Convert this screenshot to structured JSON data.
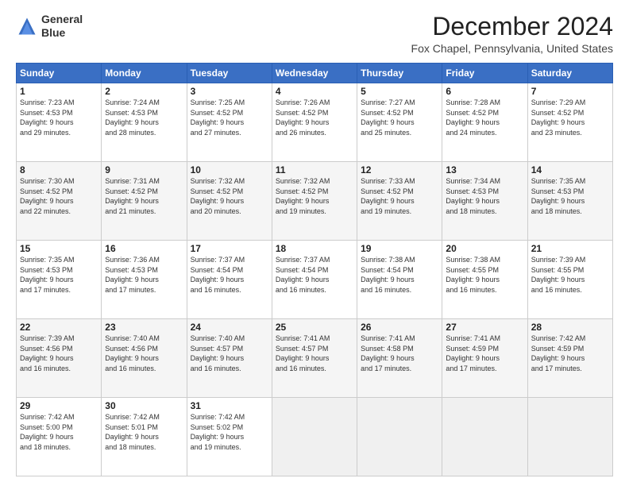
{
  "logo": {
    "line1": "General",
    "line2": "Blue"
  },
  "title": "December 2024",
  "subtitle": "Fox Chapel, Pennsylvania, United States",
  "headers": [
    "Sunday",
    "Monday",
    "Tuesday",
    "Wednesday",
    "Thursday",
    "Friday",
    "Saturday"
  ],
  "weeks": [
    [
      {
        "day": "1",
        "info": "Sunrise: 7:23 AM\nSunset: 4:53 PM\nDaylight: 9 hours\nand 29 minutes."
      },
      {
        "day": "2",
        "info": "Sunrise: 7:24 AM\nSunset: 4:53 PM\nDaylight: 9 hours\nand 28 minutes."
      },
      {
        "day": "3",
        "info": "Sunrise: 7:25 AM\nSunset: 4:52 PM\nDaylight: 9 hours\nand 27 minutes."
      },
      {
        "day": "4",
        "info": "Sunrise: 7:26 AM\nSunset: 4:52 PM\nDaylight: 9 hours\nand 26 minutes."
      },
      {
        "day": "5",
        "info": "Sunrise: 7:27 AM\nSunset: 4:52 PM\nDaylight: 9 hours\nand 25 minutes."
      },
      {
        "day": "6",
        "info": "Sunrise: 7:28 AM\nSunset: 4:52 PM\nDaylight: 9 hours\nand 24 minutes."
      },
      {
        "day": "7",
        "info": "Sunrise: 7:29 AM\nSunset: 4:52 PM\nDaylight: 9 hours\nand 23 minutes."
      }
    ],
    [
      {
        "day": "8",
        "info": "Sunrise: 7:30 AM\nSunset: 4:52 PM\nDaylight: 9 hours\nand 22 minutes."
      },
      {
        "day": "9",
        "info": "Sunrise: 7:31 AM\nSunset: 4:52 PM\nDaylight: 9 hours\nand 21 minutes."
      },
      {
        "day": "10",
        "info": "Sunrise: 7:32 AM\nSunset: 4:52 PM\nDaylight: 9 hours\nand 20 minutes."
      },
      {
        "day": "11",
        "info": "Sunrise: 7:32 AM\nSunset: 4:52 PM\nDaylight: 9 hours\nand 19 minutes."
      },
      {
        "day": "12",
        "info": "Sunrise: 7:33 AM\nSunset: 4:52 PM\nDaylight: 9 hours\nand 19 minutes."
      },
      {
        "day": "13",
        "info": "Sunrise: 7:34 AM\nSunset: 4:53 PM\nDaylight: 9 hours\nand 18 minutes."
      },
      {
        "day": "14",
        "info": "Sunrise: 7:35 AM\nSunset: 4:53 PM\nDaylight: 9 hours\nand 18 minutes."
      }
    ],
    [
      {
        "day": "15",
        "info": "Sunrise: 7:35 AM\nSunset: 4:53 PM\nDaylight: 9 hours\nand 17 minutes."
      },
      {
        "day": "16",
        "info": "Sunrise: 7:36 AM\nSunset: 4:53 PM\nDaylight: 9 hours\nand 17 minutes."
      },
      {
        "day": "17",
        "info": "Sunrise: 7:37 AM\nSunset: 4:54 PM\nDaylight: 9 hours\nand 16 minutes."
      },
      {
        "day": "18",
        "info": "Sunrise: 7:37 AM\nSunset: 4:54 PM\nDaylight: 9 hours\nand 16 minutes."
      },
      {
        "day": "19",
        "info": "Sunrise: 7:38 AM\nSunset: 4:54 PM\nDaylight: 9 hours\nand 16 minutes."
      },
      {
        "day": "20",
        "info": "Sunrise: 7:38 AM\nSunset: 4:55 PM\nDaylight: 9 hours\nand 16 minutes."
      },
      {
        "day": "21",
        "info": "Sunrise: 7:39 AM\nSunset: 4:55 PM\nDaylight: 9 hours\nand 16 minutes."
      }
    ],
    [
      {
        "day": "22",
        "info": "Sunrise: 7:39 AM\nSunset: 4:56 PM\nDaylight: 9 hours\nand 16 minutes."
      },
      {
        "day": "23",
        "info": "Sunrise: 7:40 AM\nSunset: 4:56 PM\nDaylight: 9 hours\nand 16 minutes."
      },
      {
        "day": "24",
        "info": "Sunrise: 7:40 AM\nSunset: 4:57 PM\nDaylight: 9 hours\nand 16 minutes."
      },
      {
        "day": "25",
        "info": "Sunrise: 7:41 AM\nSunset: 4:57 PM\nDaylight: 9 hours\nand 16 minutes."
      },
      {
        "day": "26",
        "info": "Sunrise: 7:41 AM\nSunset: 4:58 PM\nDaylight: 9 hours\nand 17 minutes."
      },
      {
        "day": "27",
        "info": "Sunrise: 7:41 AM\nSunset: 4:59 PM\nDaylight: 9 hours\nand 17 minutes."
      },
      {
        "day": "28",
        "info": "Sunrise: 7:42 AM\nSunset: 4:59 PM\nDaylight: 9 hours\nand 17 minutes."
      }
    ],
    [
      {
        "day": "29",
        "info": "Sunrise: 7:42 AM\nSunset: 5:00 PM\nDaylight: 9 hours\nand 18 minutes."
      },
      {
        "day": "30",
        "info": "Sunrise: 7:42 AM\nSunset: 5:01 PM\nDaylight: 9 hours\nand 18 minutes."
      },
      {
        "day": "31",
        "info": "Sunrise: 7:42 AM\nSunset: 5:02 PM\nDaylight: 9 hours\nand 19 minutes."
      },
      {
        "day": "",
        "info": ""
      },
      {
        "day": "",
        "info": ""
      },
      {
        "day": "",
        "info": ""
      },
      {
        "day": "",
        "info": ""
      }
    ]
  ]
}
